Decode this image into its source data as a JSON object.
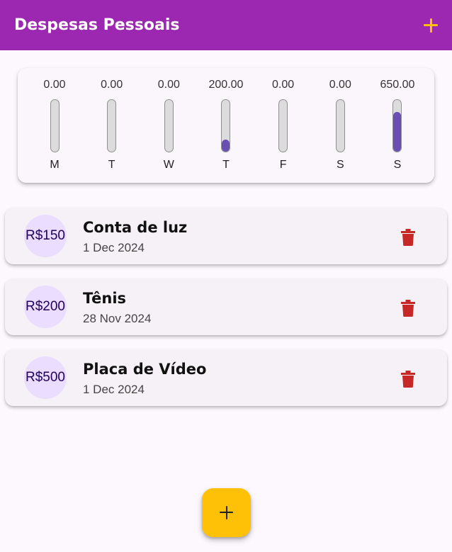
{
  "appbar": {
    "title": "Despesas Pessoais",
    "add_icon": "plus-icon",
    "background_color": "#9c27b0",
    "accent_color": "#ffc107"
  },
  "chart_data": {
    "type": "bar",
    "categories": [
      "M",
      "T",
      "W",
      "T",
      "F",
      "S",
      "S"
    ],
    "values": [
      0.0,
      0.0,
      0.0,
      200.0,
      0.0,
      0.0,
      650.0
    ],
    "value_labels": [
      "0.00",
      "0.00",
      "0.00",
      "200.00",
      "0.00",
      "0.00",
      "650.00"
    ],
    "ylim": [
      0,
      850
    ],
    "bar_color": "#6a4fb3"
  },
  "expenses": [
    {
      "amount": "R$150",
      "title": "Conta de luz",
      "date": "1 Dec 2024",
      "delete_icon": "trash-icon"
    },
    {
      "amount": "R$200",
      "title": "Tênis",
      "date": "28 Nov 2024",
      "delete_icon": "trash-icon"
    },
    {
      "amount": "R$500",
      "title": "Placa de Vídeo",
      "date": "1 Dec 2024",
      "delete_icon": "trash-icon"
    }
  ],
  "fab": {
    "icon": "plus-icon"
  },
  "colors": {
    "delete": "#c62828",
    "page_bg": "#fdf7fe"
  }
}
